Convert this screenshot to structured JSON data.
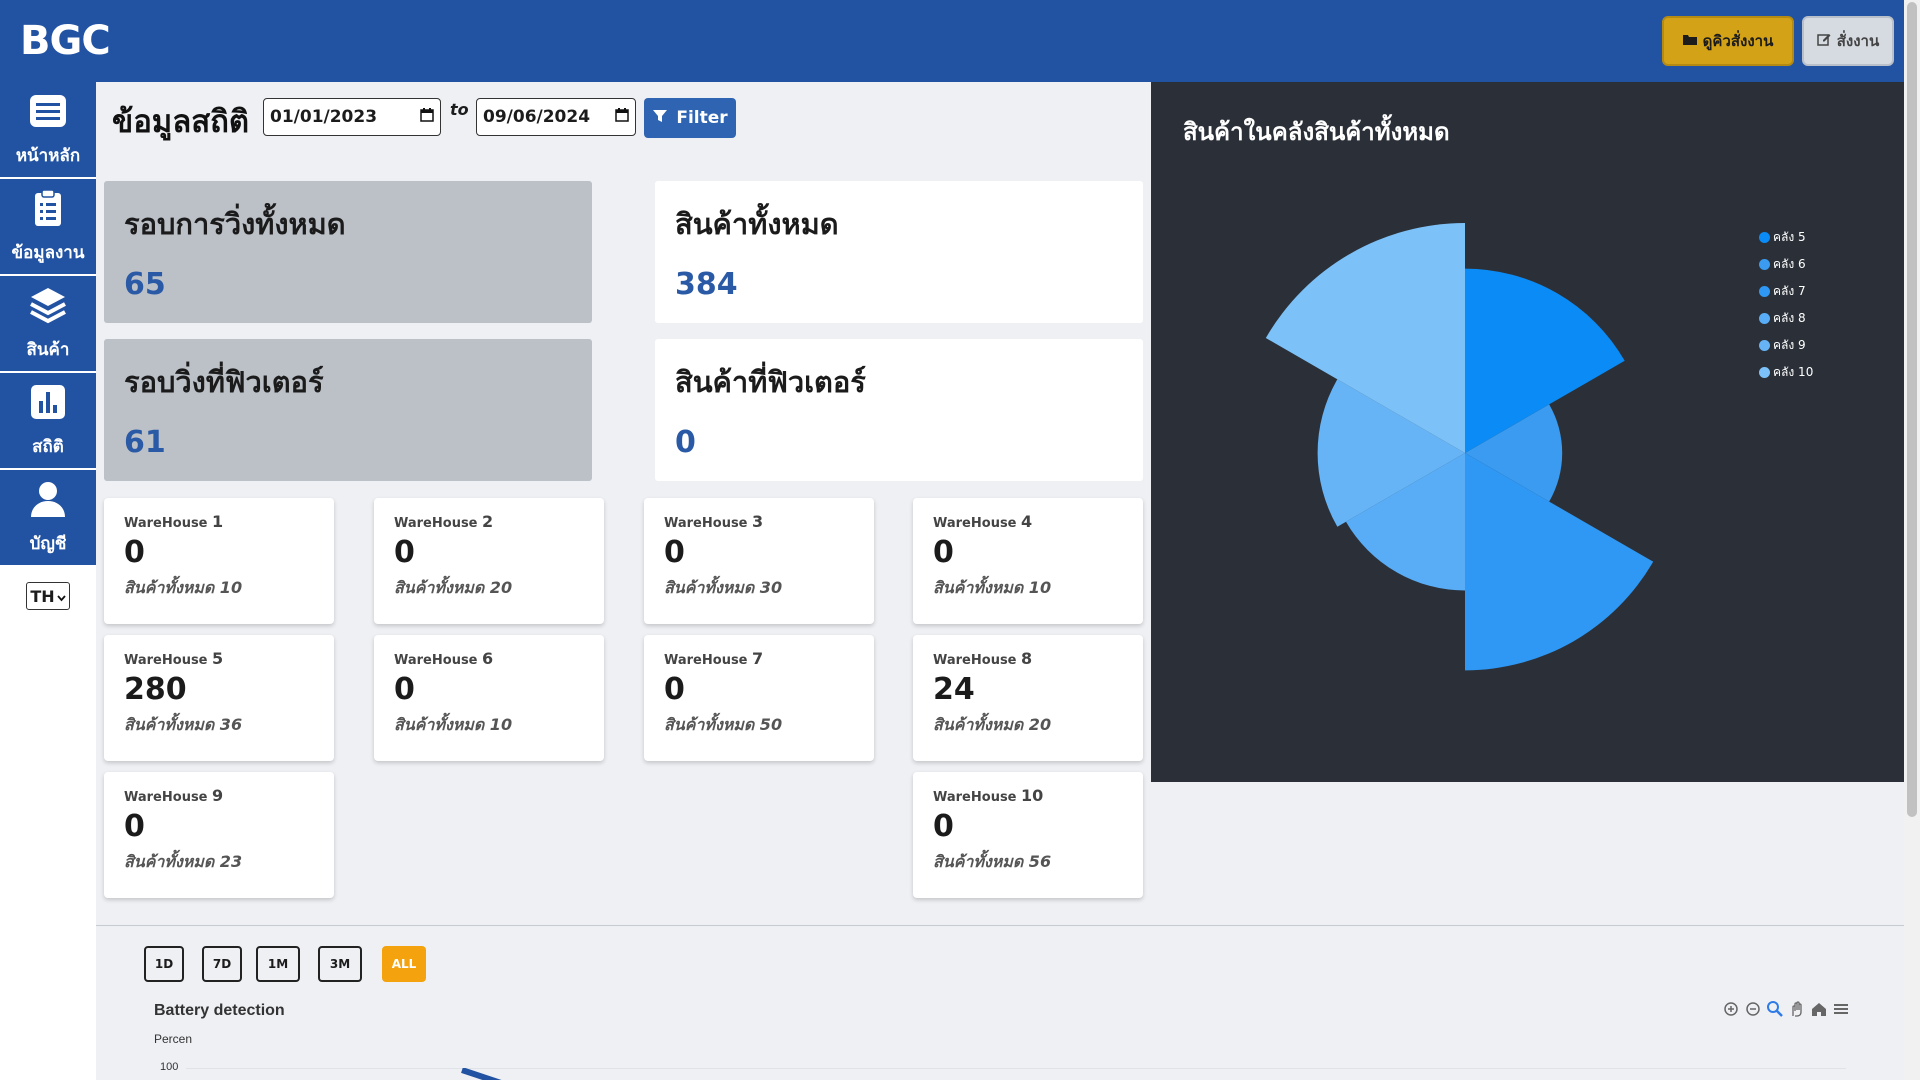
{
  "header": {
    "logo": "BGC",
    "queue_button": "ดูคิวสั่งงาน",
    "order_button": "สั่งงาน"
  },
  "sidebar": {
    "items": [
      {
        "label": "หน้าหลัก",
        "icon": "home-icon"
      },
      {
        "label": "ข้อมูลงาน",
        "icon": "clipboard-icon"
      },
      {
        "label": "สินค้า",
        "icon": "layers-icon"
      },
      {
        "label": "สถิติ",
        "icon": "bar-chart-icon"
      },
      {
        "label": "บัญชี",
        "icon": "user-icon"
      }
    ],
    "language": "TH"
  },
  "filters": {
    "title": "ข้อมูลสถิติ",
    "date_from": "01/01/2023",
    "to_label": "to",
    "date_to": "09/06/2024",
    "filter_button": "Filter"
  },
  "stats": {
    "total_runs_label": "รอบการวิ่งทั้งหมด",
    "total_runs_value": "65",
    "total_products_label": "สินค้าทั้งหมด",
    "total_products_value": "384",
    "forklift_runs_label": "รอบวิ่งที่ฟิวเตอร์",
    "forklift_runs_value": "61",
    "forklift_products_label": "สินค้าที่ฟิวเตอร์",
    "forklift_products_value": "0"
  },
  "warehouses": [
    {
      "prefix": "WareHouse",
      "num": "1",
      "value": "0",
      "total": "สินค้าทั้งหมด 10"
    },
    {
      "prefix": "WareHouse",
      "num": "2",
      "value": "0",
      "total": "สินค้าทั้งหมด 20"
    },
    {
      "prefix": "WareHouse",
      "num": "3",
      "value": "0",
      "total": "สินค้าทั้งหมด 30"
    },
    {
      "prefix": "WareHouse",
      "num": "4",
      "value": "0",
      "total": "สินค้าทั้งหมด 10"
    },
    {
      "prefix": "WareHouse",
      "num": "5",
      "value": "280",
      "total": "สินค้าทั้งหมด 36"
    },
    {
      "prefix": "WareHouse",
      "num": "6",
      "value": "0",
      "total": "สินค้าทั้งหมด 10"
    },
    {
      "prefix": "WareHouse",
      "num": "7",
      "value": "0",
      "total": "สินค้าทั้งหมด 50"
    },
    {
      "prefix": "WareHouse",
      "num": "8",
      "value": "24",
      "total": "สินค้าทั้งหมด 20"
    },
    {
      "prefix": "WareHouse",
      "num": "9",
      "value": "0",
      "total": "สินค้าทั้งหมด 23"
    },
    {
      "prefix": "WareHouse",
      "num": "10",
      "value": "0",
      "total": "สินค้าทั้งหมด 56"
    }
  ],
  "chart_data": [
    {
      "type": "pie",
      "subtype": "polar-area",
      "title": "สินค้าในคลังสินค้าทั้งหมด",
      "legend_position": "top-right",
      "categories": [
        "คลัง 5",
        "คลัง 6",
        "คลัง 7",
        "คลัง 8",
        "คลัง 9",
        "คลัง 10"
      ],
      "values": [
        36,
        10,
        50,
        20,
        23,
        56
      ],
      "colors": [
        "#0a8bf5",
        "#3a9bf0",
        "#2e98f4",
        "#58adf6",
        "#66b4f6",
        "#7cc2f8"
      ]
    },
    {
      "type": "line",
      "title": "Battery detection",
      "ylabel": "Percen",
      "y_ticks": [
        "100"
      ],
      "ranges": [
        "1D",
        "7D",
        "1M",
        "3M",
        "ALL"
      ],
      "active_range": "ALL"
    }
  ]
}
